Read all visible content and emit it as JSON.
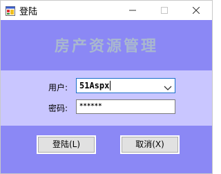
{
  "window": {
    "title": "登陆"
  },
  "banner": {
    "title": "房产资源管理"
  },
  "form": {
    "username_label": "用户:",
    "username_value": "51Aspx",
    "password_label": "密码:",
    "password_masked": "******"
  },
  "buttons": {
    "login_label": "登陆(L)",
    "cancel_label": "取消(X)"
  },
  "colors": {
    "background": "#8b88f5",
    "form_band": "#c9c6ff",
    "banner_text": "#a9b8cf",
    "focus_border": "#1a6fc9"
  },
  "icons": {
    "app": "app-icon",
    "minimize": "minimize-icon",
    "maximize": "maximize-icon",
    "close": "close-icon",
    "dropdown": "chevron-down-icon"
  }
}
